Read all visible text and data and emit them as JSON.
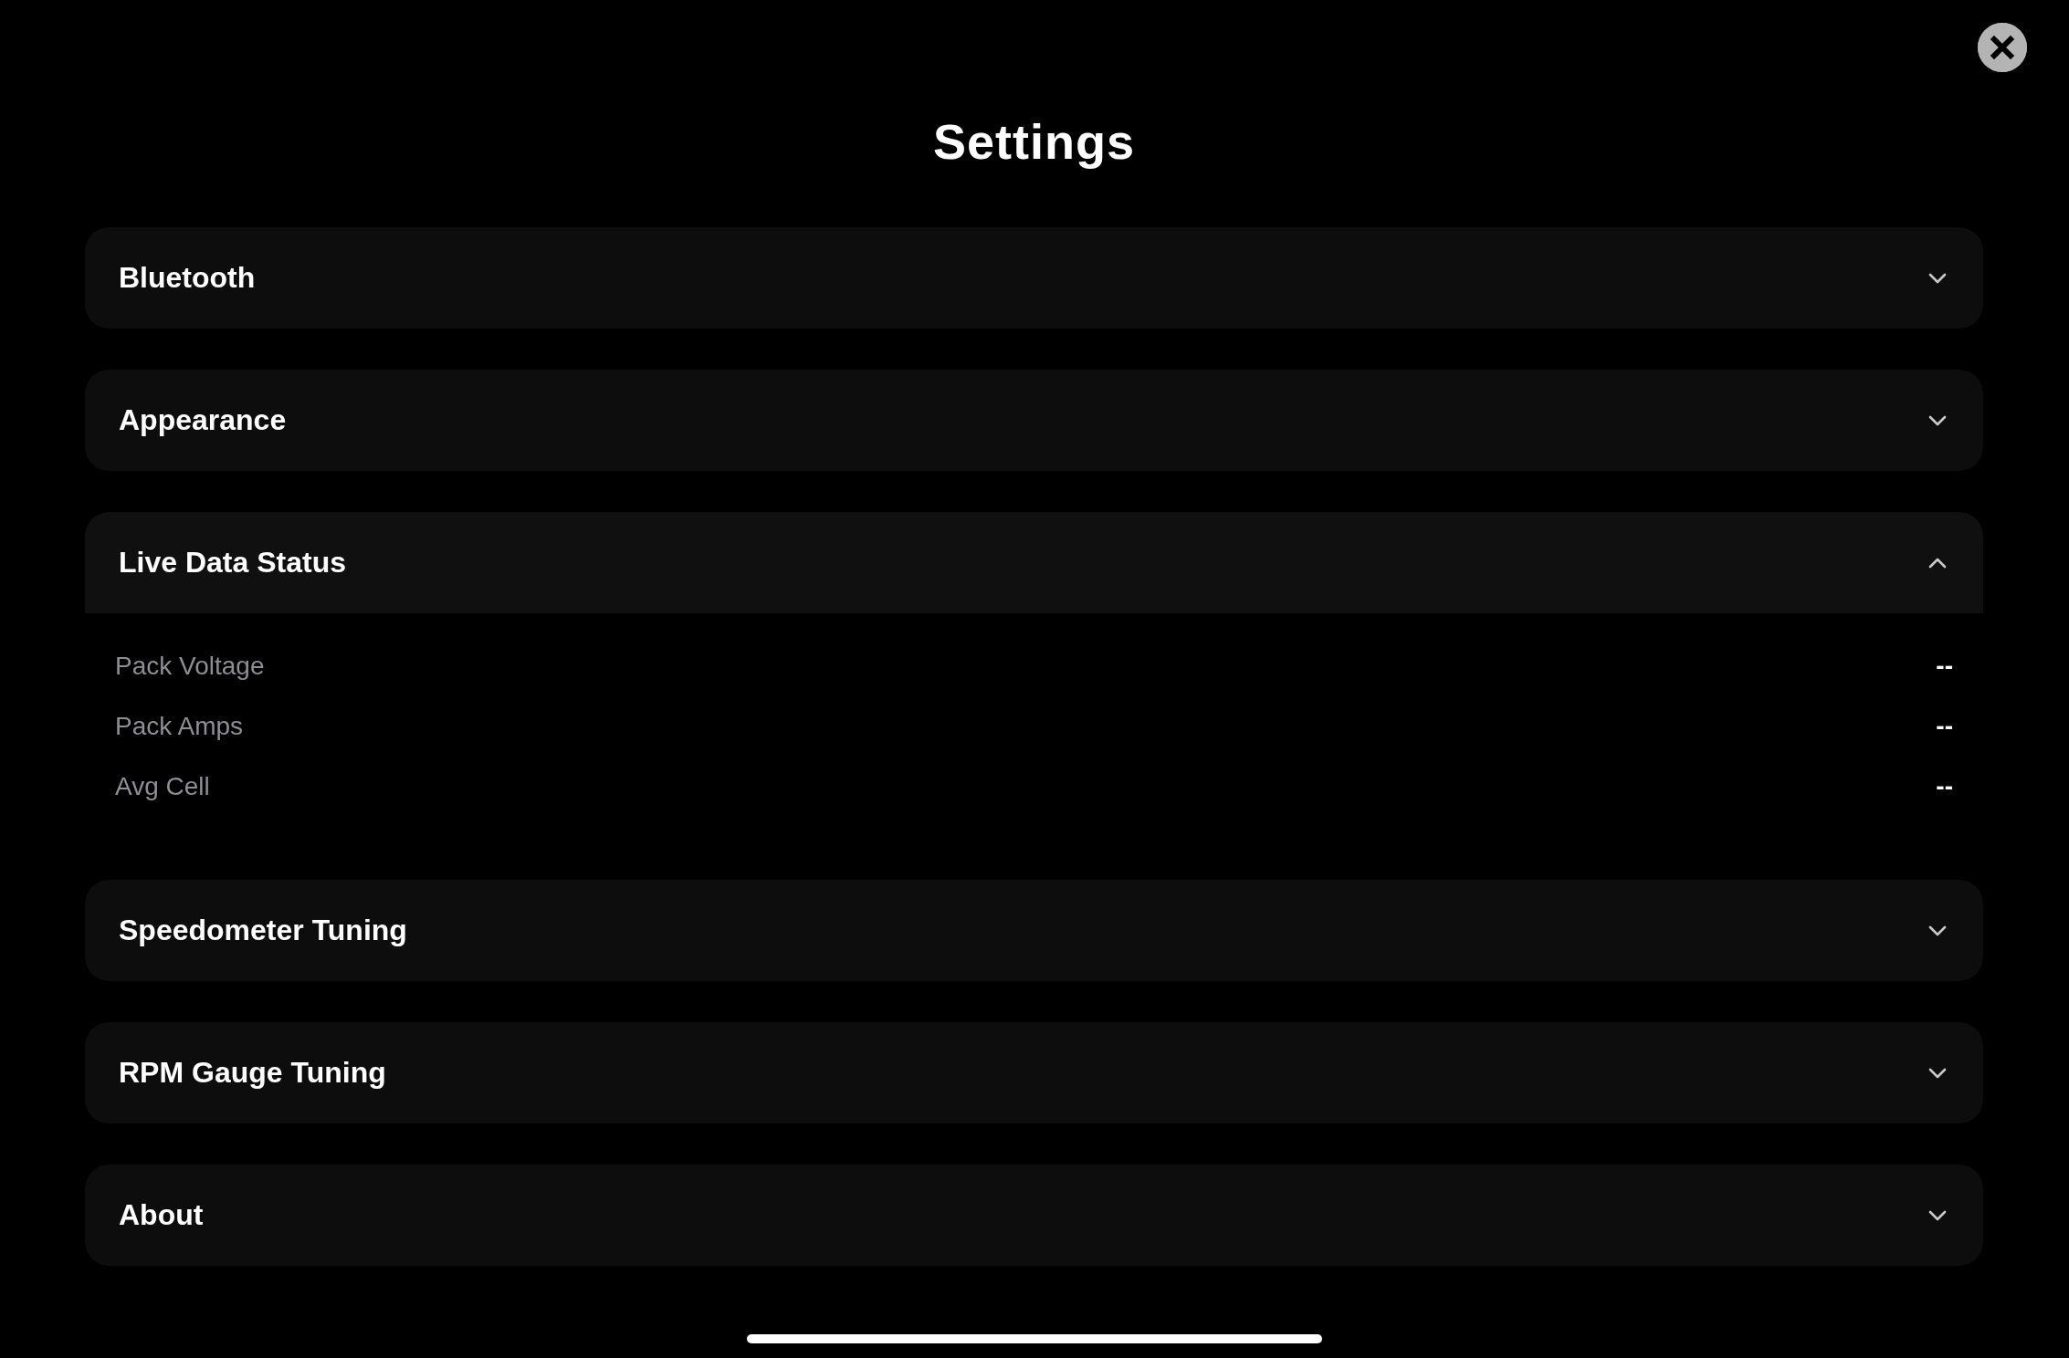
{
  "title": "Settings",
  "sections": [
    {
      "label": "Bluetooth",
      "expanded": false
    },
    {
      "label": "Appearance",
      "expanded": false
    },
    {
      "label": "Live Data Status",
      "expanded": true,
      "rows": [
        {
          "label": "Pack Voltage",
          "value": "--"
        },
        {
          "label": "Pack Amps",
          "value": "--"
        },
        {
          "label": "Avg Cell",
          "value": "--"
        }
      ]
    },
    {
      "label": "Speedometer Tuning",
      "expanded": false
    },
    {
      "label": "RPM Gauge Tuning",
      "expanded": false
    },
    {
      "label": "About",
      "expanded": false
    }
  ]
}
